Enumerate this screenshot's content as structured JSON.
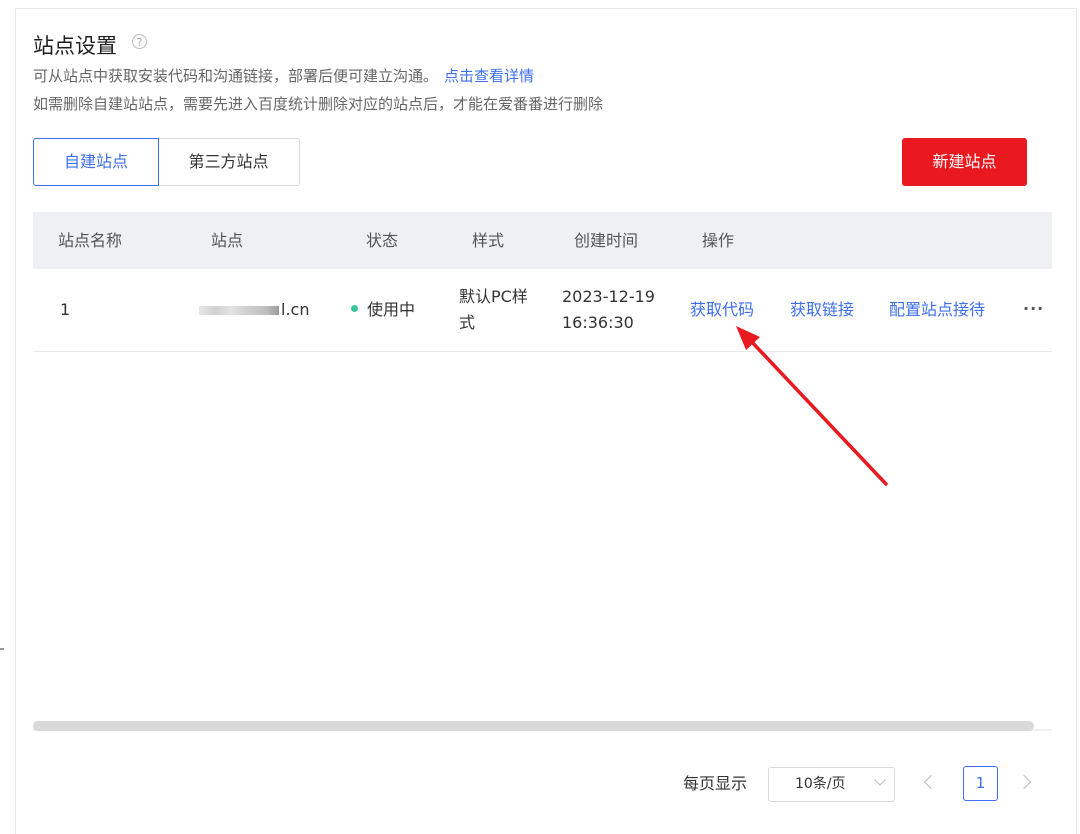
{
  "page": {
    "title": "站点设置",
    "help_icon_glyph": "?",
    "description_line1": "可从站点中获取安装代码和沟通链接，部署后便可建立沟通。",
    "description_link": "点击查看详情",
    "description_line2": "如需删除自建站站点，需要先进入百度统计删除对应的站点后，才能在爱番番进行删除"
  },
  "tabs": [
    {
      "label": "自建站点",
      "active": true
    },
    {
      "label": "第三方站点",
      "active": false
    }
  ],
  "new_site_button": "新建站点",
  "table": {
    "columns": [
      "站点名称",
      "站点",
      "状态",
      "样式",
      "创建时间",
      "操作"
    ],
    "rows": [
      {
        "name": "1",
        "site_suffix": "l.cn",
        "status": "使用中",
        "style_line1": "默认PC样",
        "style_line2": "式",
        "created_date": "2023-12-19",
        "created_time": "16:36:30",
        "actions": [
          "获取代码",
          "获取链接",
          "配置站点接待"
        ],
        "more": "···"
      }
    ]
  },
  "pagination": {
    "per_page_label": "每页显示",
    "page_size": "10条/页",
    "current_page": "1"
  },
  "colors": {
    "accent": "#3d6ff0",
    "primary_button": "#e9191f",
    "status_active": "#3cc49a",
    "annotation_arrow": "#e8191f"
  }
}
